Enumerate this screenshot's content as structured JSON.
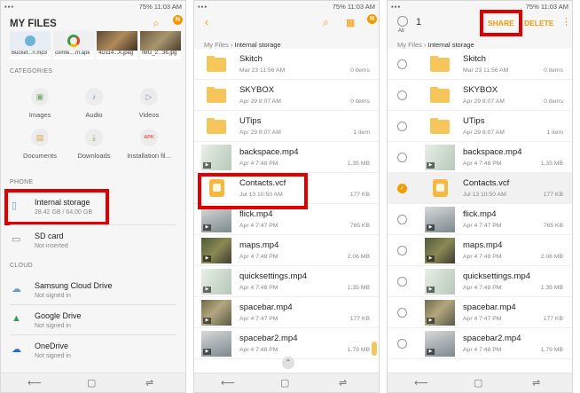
{
  "status": {
    "time": "11:03 AM",
    "battery": "75%"
  },
  "nav": {
    "back": "⟵",
    "home": "▢",
    "recent": "⇌"
  },
  "p1": {
    "title": "MY FILES",
    "badge": "N",
    "recent_thumbs": [
      "Bucket...n.mp3",
      "comte....m.apk",
      "4D114...A.jpeg",
      "IMG_2...36.jpg"
    ],
    "categories_label": "CATEGORIES",
    "categories": [
      {
        "label": "Images",
        "icon": "image-icon"
      },
      {
        "label": "Audio",
        "icon": "music-note-icon"
      },
      {
        "label": "Videos",
        "icon": "video-icon"
      },
      {
        "label": "Documents",
        "icon": "document-icon"
      },
      {
        "label": "Downloads",
        "icon": "download-icon"
      },
      {
        "label": "Installation fil...",
        "icon": "apk-icon"
      }
    ],
    "apk_glyph": "APK",
    "phone_label": "PHONE",
    "internal": {
      "title": "Internal storage",
      "sub": "28.42 GB / 64.00 GB"
    },
    "sdcard": {
      "title": "SD card",
      "sub": "Not inserted"
    },
    "cloud_label": "CLOUD",
    "cloud": [
      {
        "title": "Samsung Cloud Drive",
        "sub": "Not signed in",
        "icon": "cloud-icon"
      },
      {
        "title": "Google Drive",
        "sub": "Not signed in",
        "icon": "google-drive-icon"
      },
      {
        "title": "OneDrive",
        "sub": "Not signed in",
        "icon": "onedrive-icon"
      }
    ]
  },
  "breadcrumb": {
    "root": "My Files",
    "sep": "›",
    "current": "Internal storage"
  },
  "files": [
    {
      "name": "Skitch",
      "date": "Mar 23 11:56 AM",
      "size": "0 items",
      "kind": "folder"
    },
    {
      "name": "SKYBOX",
      "date": "Apr 29 8:07 AM",
      "size": "0 items",
      "kind": "folder"
    },
    {
      "name": "UTips",
      "date": "Apr 29 8:07 AM",
      "size": "1 item",
      "kind": "folder"
    },
    {
      "name": "backspace.mp4",
      "date": "Apr 4 7:48 PM",
      "size": "1.35 MB",
      "kind": "video"
    },
    {
      "name": "Contacts.vcf",
      "date": "Jul 13 10:50 AM",
      "size": "177 KB",
      "kind": "vcf"
    },
    {
      "name": "flick.mp4",
      "date": "Apr 4 7:47 PM",
      "size": "765 KB",
      "kind": "video"
    },
    {
      "name": "maps.mp4",
      "date": "Apr 4 7:48 PM",
      "size": "2.06 MB",
      "kind": "video"
    },
    {
      "name": "quicksettings.mp4",
      "date": "Apr 4 7:48 PM",
      "size": "1.35 MB",
      "kind": "video"
    },
    {
      "name": "spacebar.mp4",
      "date": "Apr 4 7:47 PM",
      "size": "177 KB",
      "kind": "video"
    },
    {
      "name": "spacebar2.mp4",
      "date": "Apr 4 7:48 PM",
      "size": "1.79 MB",
      "kind": "video"
    }
  ],
  "p2": {
    "badge": "N"
  },
  "p3": {
    "count": "1",
    "all_label": "All",
    "share": "SHARE",
    "delete": "DELETE",
    "more": "⋮"
  },
  "colors": {
    "accent": "#f29a00",
    "highlight": "#e00000",
    "folder": "#f6c65b"
  }
}
